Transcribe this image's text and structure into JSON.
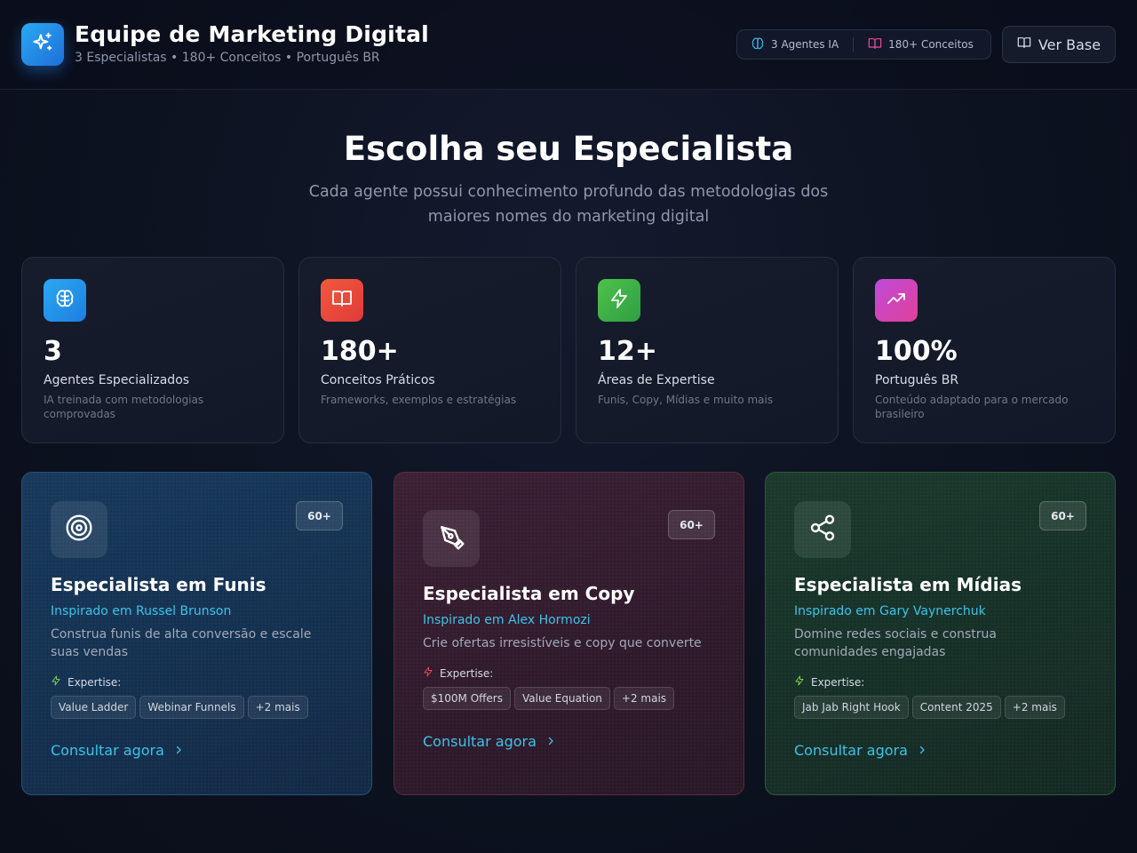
{
  "header": {
    "title": "Equipe de Marketing Digital",
    "subtitle": "3 Especialistas • 180+ Conceitos • Português BR",
    "logo_icon": "sparkles-icon",
    "stats": [
      {
        "label": "3 Agentes IA",
        "icon": "brain-icon",
        "color": "#38b6e8"
      },
      {
        "label": "180+ Conceitos",
        "icon": "book-icon",
        "color": "#e64aa0"
      }
    ],
    "ver_base_label": "Ver Base"
  },
  "hero": {
    "title": "Escolha seu Especialista",
    "subtitle": "Cada agente possui conhecimento profundo das metodologias dos maiores nomes do marketing digital"
  },
  "stats": [
    {
      "value": "3",
      "title": "Agentes Especializados",
      "desc": "IA treinada com metodologias comprovadas",
      "icon": "brain-icon",
      "colors": [
        "#2aa8f2",
        "#1e7fe0"
      ]
    },
    {
      "value": "180+",
      "title": "Conceitos Práticos",
      "desc": "Frameworks, exemplos e estratégias",
      "icon": "book-open-icon",
      "colors": [
        "#f25a3c",
        "#e03a3a"
      ]
    },
    {
      "value": "12+",
      "title": "Áreas de Expertise",
      "desc": "Funis, Copy, Mídias e muito mais",
      "icon": "lightning-icon",
      "colors": [
        "#4ec24a",
        "#2f9e44"
      ]
    },
    {
      "value": "100%",
      "title": "Português BR",
      "desc": "Conteúdo adaptado para o mercado brasileiro",
      "icon": "trending-up-icon",
      "colors": [
        "#c04ad8",
        "#e0409a"
      ]
    }
  ],
  "agents": [
    {
      "badge": "60+",
      "title": "Especialista em Funis",
      "inspired": "Inspirado em Russel Brunson",
      "desc": "Construa funis de alta conversão e escale suas vendas",
      "expertise_label": "Expertise:",
      "tags": [
        "Value Ladder",
        "Webinar Funnels",
        "+2 mais"
      ],
      "cta": "Consultar agora",
      "icon": "target-icon",
      "accent": "#3b82f6"
    },
    {
      "badge": "60+",
      "title": "Especialista em Copy",
      "inspired": "Inspirado em Alex Hormozi",
      "desc": "Crie ofertas irresistíveis e copy que converte",
      "expertise_label": "Expertise:",
      "tags": [
        "$100M Offers",
        "Value Equation",
        "+2 mais"
      ],
      "cta": "Consultar agora",
      "icon": "pen-tool-icon",
      "accent": "#e11d48"
    },
    {
      "badge": "60+",
      "title": "Especialista em Mídias",
      "inspired": "Inspirado em Gary Vaynerchuk",
      "desc": "Domine redes sociais e construa comunidades engajadas",
      "expertise_label": "Expertise:",
      "tags": [
        "Jab Jab Right Hook",
        "Content 2025",
        "+2 mais"
      ],
      "cta": "Consultar agora",
      "icon": "share-icon",
      "accent": "#22c55e"
    }
  ]
}
